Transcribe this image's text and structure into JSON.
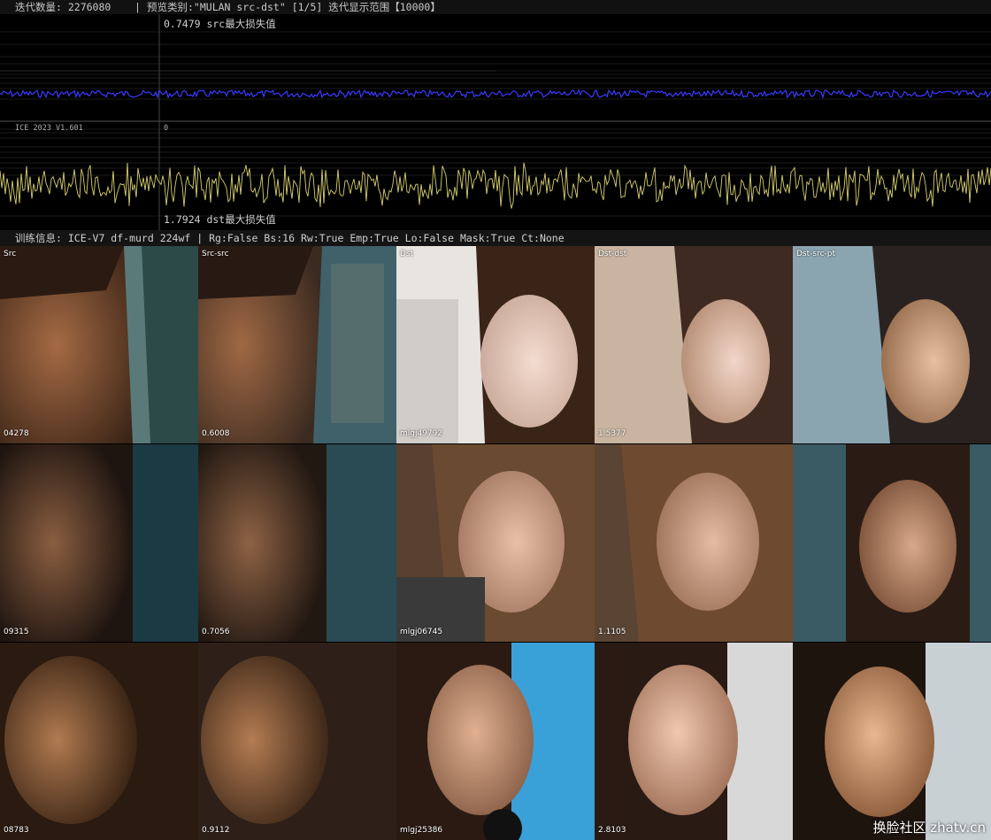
{
  "header": {
    "iterations": "迭代数量: 2276080",
    "separator": "|",
    "preview": "预览类别:\"MULAN src-dst\" [1/5] 迭代显示范围【10000】"
  },
  "loss_graph": {
    "src_max_label": "0.7479 src最大损失值",
    "dst_max_label": "1.7924 dst最大损失值",
    "version": "ICE 2023 V1.601",
    "zero_label": "0",
    "src_color": "#3a3aff",
    "dst_color": "#d8d070"
  },
  "info": {
    "text": "训练信息: ICE-V7 df-murd 224wf | Rg:False Bs:16 Rw:True Emp:True Lo:False Mask:True Ct:None"
  },
  "columns": [
    "Src",
    "Src-src",
    "Dst",
    "Dst-dst",
    "Dst-src-pt"
  ],
  "rows": [
    [
      "04278",
      "0.6008",
      "mlgj49792",
      "1.5377"
    ],
    [
      "09315",
      "0.7056",
      "mlgj06745",
      "1.1105"
    ],
    [
      "08783",
      "0.9112",
      "mlgj25386",
      "2.8103"
    ]
  ],
  "watermark": "换脸社区 zhatv.cn"
}
